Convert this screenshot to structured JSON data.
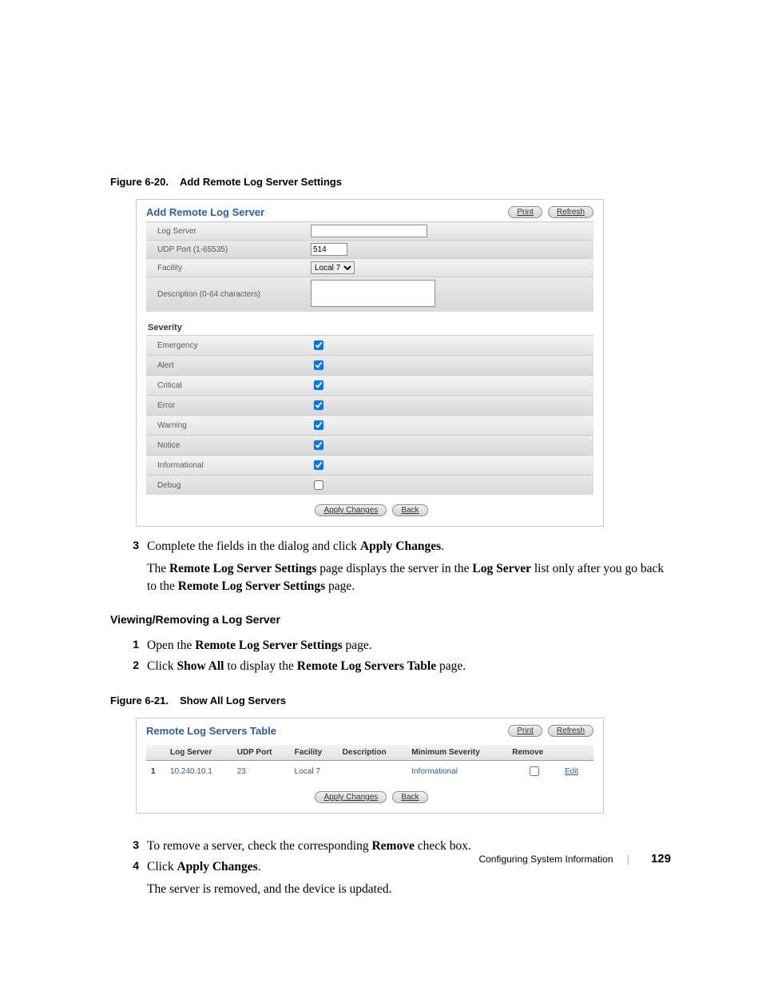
{
  "fig1": {
    "label": "Figure 6-20.",
    "title": "Add Remote Log Server Settings"
  },
  "shot1": {
    "title": "Add Remote Log Server",
    "print": "Print",
    "refresh": "Refresh",
    "rows": {
      "log_server": "Log Server",
      "udp_port": "UDP Port (1-65535)",
      "udp_port_val": "514",
      "facility": "Facility",
      "facility_val": "Local 7",
      "description": "Description (0-64 characters)"
    },
    "severity_head": "Severity",
    "severity": [
      {
        "name": "Emergency",
        "checked": true
      },
      {
        "name": "Alert",
        "checked": true
      },
      {
        "name": "Critical",
        "checked": true
      },
      {
        "name": "Error",
        "checked": true
      },
      {
        "name": "Warning",
        "checked": true
      },
      {
        "name": "Notice",
        "checked": true
      },
      {
        "name": "Informational",
        "checked": true
      },
      {
        "name": "Debug",
        "checked": false
      }
    ],
    "apply": "Apply Changes",
    "back": "Back"
  },
  "list1": {
    "n3a": "Complete the fields in the dialog and click ",
    "n3b": "Apply Changes",
    "n3c": ".",
    "n3p2a": "The ",
    "n3p2b": "Remote Log Server Settings",
    "n3p2c": " page displays the server in the ",
    "n3p2d": "Log Server",
    "n3p2e": " list only after you go back to the ",
    "n3p2f": "Remote Log Server Settings",
    "n3p2g": " page."
  },
  "subhead1": "Viewing/Removing a Log Server",
  "list2": {
    "n1a": "Open the ",
    "n1b": "Remote Log Server Settings",
    "n1c": " page.",
    "n2a": "Click ",
    "n2b": "Show All",
    "n2c": " to display the ",
    "n2d": "Remote Log Servers Table",
    "n2e": " page."
  },
  "fig2": {
    "label": "Figure 6-21.",
    "title": "Show All Log Servers"
  },
  "shot2": {
    "title": "Remote Log Servers Table",
    "print": "Print",
    "refresh": "Refresh",
    "headers": [
      "",
      "Log Server",
      "UDP Port",
      "Facility",
      "Description",
      "Minimum Severity",
      "Remove",
      ""
    ],
    "row": {
      "idx": "1",
      "log_server": "10.240.10.1",
      "udp_port": "23",
      "facility": "Local 7",
      "description": "",
      "min_sev": "Informational",
      "edit": "Edit"
    },
    "apply": "Apply Changes",
    "back": "Back"
  },
  "list3": {
    "n3a": "To remove a server, check the corresponding ",
    "n3b": "Remove",
    "n3c": " check box.",
    "n4a": "Click ",
    "n4b": "Apply Changes",
    "n4c": ".",
    "n4p2": "The server is removed, and the device is updated."
  },
  "footer": {
    "section": "Configuring System Information",
    "page": "129"
  }
}
